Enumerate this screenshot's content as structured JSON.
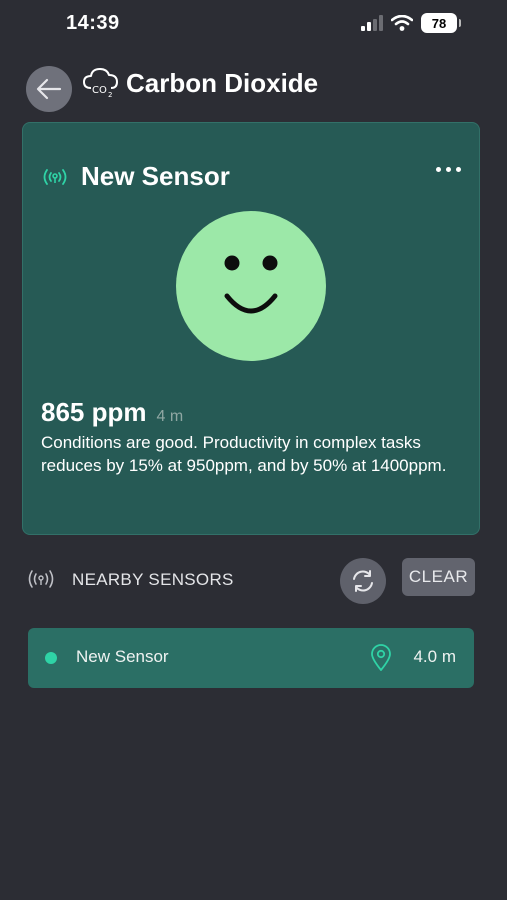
{
  "status_bar": {
    "time": "14:39",
    "battery": "78"
  },
  "header": {
    "title": "Carbon Dioxide",
    "icon": "co2-cloud-icon"
  },
  "sensor_card": {
    "name": "New Sensor",
    "reading_value": "865 ppm",
    "reading_age": "4 m",
    "description": "Conditions are good. Productivity in complex tasks reduces by 15% at 950ppm, and by 50% at 1400ppm.",
    "face": "smiley-face",
    "face_color": "#9ce8a8",
    "card_color": "#265a55",
    "accent_color": "#2fd3a6"
  },
  "nearby": {
    "label": "NEARBY SENSORS",
    "clear_label": "CLEAR",
    "sensors": [
      {
        "name": "New Sensor",
        "distance": "4.0 m"
      }
    ]
  }
}
